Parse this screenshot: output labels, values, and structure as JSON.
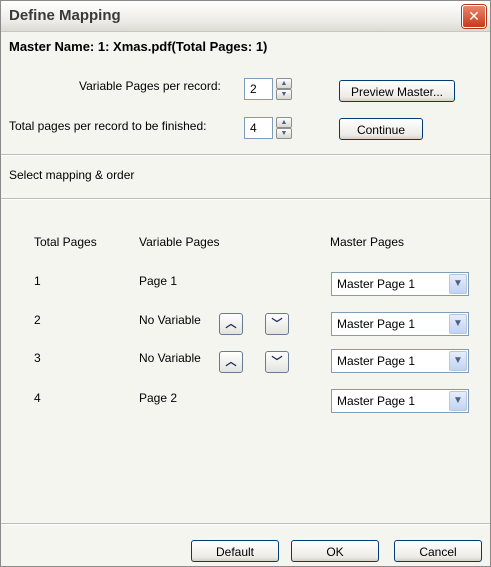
{
  "window": {
    "title": "Define Mapping",
    "close_symbol": "✕"
  },
  "master_name": "Master Name: 1: Xmas.pdf(Total Pages: 1)",
  "variable_pages": {
    "label": "Variable Pages per record:",
    "value": "2"
  },
  "total_pages": {
    "label": "Total pages per record to be finished:",
    "value": "4"
  },
  "buttons": {
    "preview": "Preview Master...",
    "continue": "Continue",
    "default": "Default",
    "ok": "OK",
    "cancel": "Cancel"
  },
  "section_label": "Select mapping & order",
  "table": {
    "headers": {
      "total": "Total Pages",
      "variable": "Variable Pages",
      "master": "Master Pages"
    },
    "rows": [
      {
        "total": "1",
        "variable": "Page 1",
        "master": "Master Page 1",
        "has_arrows": false
      },
      {
        "total": "2",
        "variable": "No Variable",
        "master": "Master Page 1",
        "has_arrows": true
      },
      {
        "total": "3",
        "variable": "No Variable",
        "master": "Master Page 1",
        "has_arrows": true
      },
      {
        "total": "4",
        "variable": "Page 2",
        "master": "Master Page 1",
        "has_arrows": false
      }
    ]
  },
  "icons": {
    "up": "up-arrow-icon",
    "down": "down-arrow-icon",
    "combo": "chevron-down-icon"
  }
}
